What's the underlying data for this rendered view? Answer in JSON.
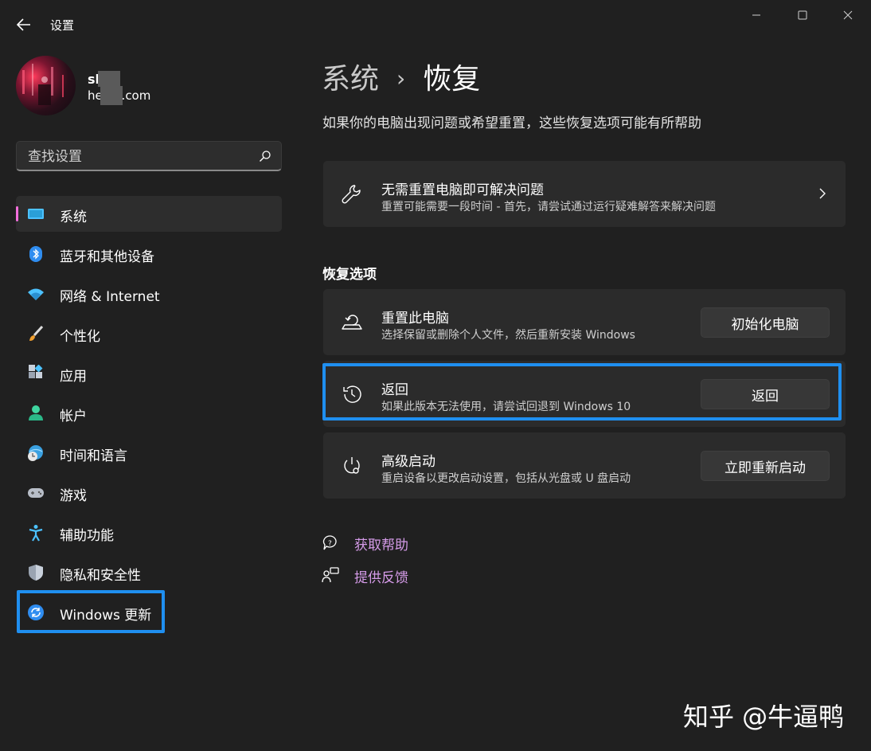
{
  "window": {
    "title": "设置"
  },
  "user": {
    "name": "sh",
    "email": "he qq.com"
  },
  "search": {
    "placeholder": "查找设置"
  },
  "sidebar": {
    "items": [
      {
        "label": "系统",
        "icon": "system-icon"
      },
      {
        "label": "蓝牙和其他设备",
        "icon": "bluetooth-icon"
      },
      {
        "label": "网络 & Internet",
        "icon": "wifi-icon"
      },
      {
        "label": "个性化",
        "icon": "brush-icon"
      },
      {
        "label": "应用",
        "icon": "apps-icon"
      },
      {
        "label": "帐户",
        "icon": "account-icon"
      },
      {
        "label": "时间和语言",
        "icon": "globe-clock-icon"
      },
      {
        "label": "游戏",
        "icon": "gamepad-icon"
      },
      {
        "label": "辅助功能",
        "icon": "accessibility-icon"
      },
      {
        "label": "隐私和安全性",
        "icon": "shield-icon"
      },
      {
        "label": "Windows 更新",
        "icon": "update-icon"
      }
    ]
  },
  "main": {
    "breadcrumb": {
      "parent": "系统",
      "separator": "›",
      "current": "恢复"
    },
    "subtitle": "如果你的电脑出现问题或希望重置，这些恢复选项可能有所帮助",
    "fix_card": {
      "title": "无需重置电脑即可解决问题",
      "desc": "重置可能需要一段时间 - 首先，请尝试通过运行疑难解答来解决问题"
    },
    "section_title": "恢复选项",
    "options": [
      {
        "title": "重置此电脑",
        "desc": "选择保留或删除个人文件，然后重新安装 Windows",
        "button": "初始化电脑"
      },
      {
        "title": "返回",
        "desc": "如果此版本无法使用，请尝试回退到 Windows 10",
        "button": "返回"
      },
      {
        "title": "高级启动",
        "desc": "重启设备以更改启动设置，包括从光盘或 U 盘启动",
        "button": "立即重新启动"
      }
    ],
    "links": [
      {
        "label": "获取帮助"
      },
      {
        "label": "提供反馈"
      }
    ]
  },
  "watermark": "知乎 @牛逼鸭",
  "colors": {
    "background": "#202020",
    "card": "#2b2b2b",
    "accent": "#f36fdc",
    "link": "#d59be8",
    "highlight": "#1f8ff0"
  }
}
